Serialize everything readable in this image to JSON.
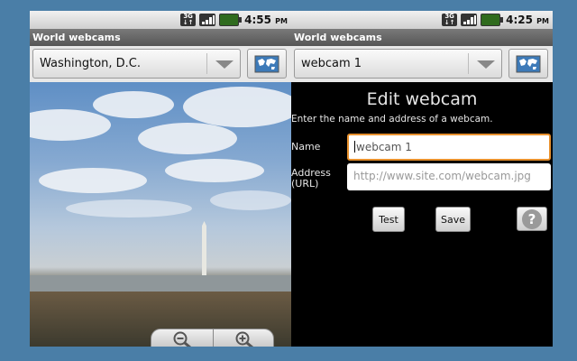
{
  "left_screen": {
    "status": {
      "network": "3G",
      "time": "4:55",
      "ampm": "PM"
    },
    "app_title": "World webcams",
    "selected_location": "Washington, D.C."
  },
  "right_screen": {
    "status": {
      "network": "3G",
      "time": "4:25",
      "ampm": "PM"
    },
    "app_title": "World webcams",
    "selected_webcam": "webcam 1",
    "heading": "Edit webcam",
    "description": "Enter the name and address of a webcam.",
    "name_label": "Name",
    "name_value": "webcam 1",
    "address_label_line1": "Address",
    "address_label_line2": "(URL)",
    "address_placeholder": "http://www.site.com/webcam.jpg",
    "test_button": "Test",
    "save_button": "Save",
    "help_glyph": "?"
  },
  "colors": {
    "background": "#4a7ea7",
    "focus_border": "#e8912e"
  },
  "icons": [
    "3g-icon",
    "signal-icon",
    "battery-icon",
    "map-icon",
    "zoom-out-icon",
    "zoom-in-icon",
    "help-icon",
    "dropdown-arrow-icon"
  ]
}
